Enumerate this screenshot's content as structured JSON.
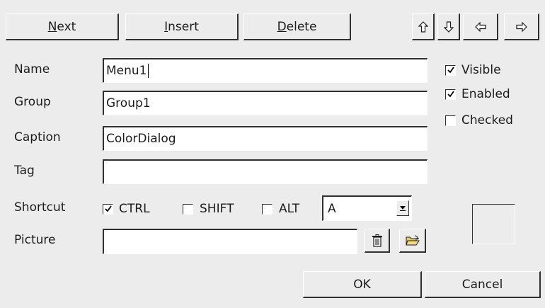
{
  "toolbar": {
    "next": {
      "pre": "",
      "key": "N",
      "post": "ext"
    },
    "insert": {
      "pre": "",
      "key": "I",
      "post": "nsert"
    },
    "delete": {
      "pre": "",
      "key": "D",
      "post": "elete"
    }
  },
  "form": {
    "name_label": "Name",
    "name_value": "Menu1",
    "group_label": "Group",
    "group_value": "Group1",
    "caption_label": "Caption",
    "caption_value": "ColorDialog",
    "tag_label": "Tag",
    "tag_value": "",
    "shortcut_label": "Shortcut",
    "ctrl_label": "CTRL",
    "ctrl_checked": true,
    "shift_label": "SHIFT",
    "shift_checked": false,
    "alt_label": "ALT",
    "alt_checked": false,
    "key_value": "A",
    "picture_label": "Picture",
    "picture_value": ""
  },
  "options": {
    "visible_label": "Visible",
    "visible_checked": true,
    "enabled_label": "Enabled",
    "enabled_checked": true,
    "checked_label": "Checked",
    "checked_checked": false
  },
  "footer": {
    "ok_label": "OK",
    "cancel_label": "Cancel"
  },
  "icons": {
    "move_up": "arrow-up-icon",
    "move_down": "arrow-down-icon",
    "move_left": "arrow-left-icon",
    "move_right": "arrow-right-icon",
    "clear_picture": "trash-icon",
    "open_picture": "folder-open-icon",
    "dropdown": "chevron-down-icon"
  },
  "colors": {
    "background": "#ececec",
    "field": "#ffffff",
    "shadow": "#303030"
  }
}
